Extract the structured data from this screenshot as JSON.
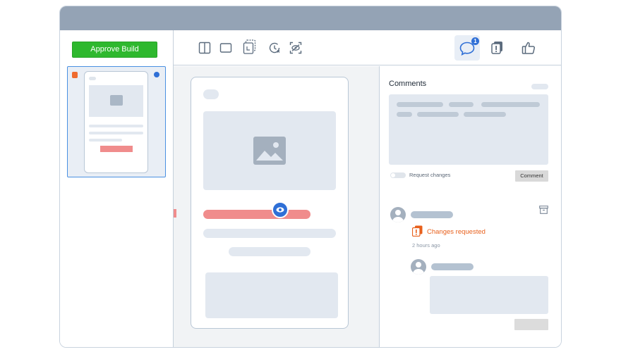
{
  "sidebar": {
    "approve_label": "Approve Build"
  },
  "toolbar": {
    "icons": [
      "split-view-icon",
      "single-view-icon",
      "overlay-icon",
      "history-icon",
      "focus-view-icon"
    ],
    "comments_badge": "1"
  },
  "panel": {
    "title": "Comments",
    "request_changes_label": "Request changes",
    "comment_button": "Comment",
    "activity": {
      "status": "Changes requested",
      "time": "2 hours ago"
    }
  },
  "colors": {
    "approve": "#2eb82e",
    "accent": "#2f6fd6",
    "warning": "#e8601c",
    "highlight": "#f08c8c"
  }
}
